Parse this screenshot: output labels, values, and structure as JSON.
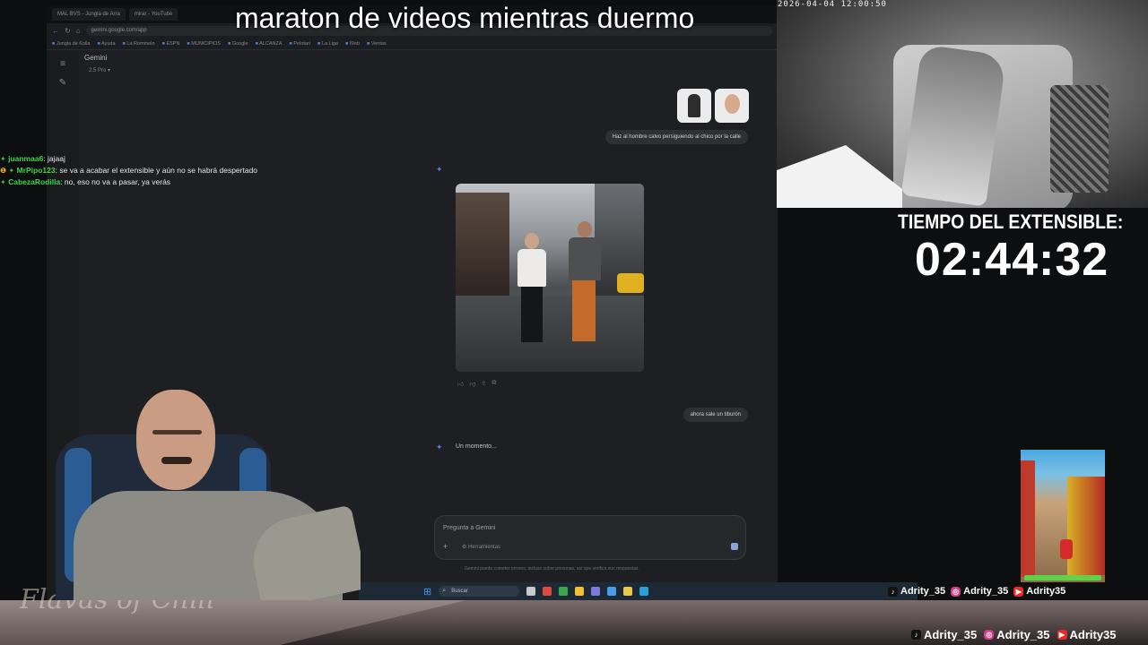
{
  "stream": {
    "title": "maraton de videos mientras duermo",
    "camera_timestamp": "2026-04-04 12:00:50",
    "timer_label": "TIEMPO DEL EXTENSIBLE:",
    "timer_value": "02:44:32",
    "watermark": "Flavas of Chill"
  },
  "chat": [
    {
      "icon": "chat-badge-icon",
      "user": "juanmaa6",
      "message": "jajaaj",
      "user_color": "#3cd44a"
    },
    {
      "icon": "warning-badge-icon",
      "user": "MrPipo123",
      "message": "se va a acabar el extensible y aún no se habrá despertado",
      "user_color": "#3cd44a"
    },
    {
      "icon": "chat-badge-icon",
      "user": "CabezaRodilla",
      "message": "no, eso no va a pasar, ya verás",
      "user_color": "#3cd44a"
    }
  ],
  "socials": {
    "top": [
      {
        "network": "tiktok",
        "handle": "Adrity_35"
      },
      {
        "network": "instagram",
        "handle": "Adrity_35"
      },
      {
        "network": "youtube",
        "handle": "Adrity35"
      }
    ],
    "bottom": [
      {
        "network": "tiktok",
        "handle": "Adrity_35"
      },
      {
        "network": "instagram",
        "handle": "Adrity_35"
      },
      {
        "network": "youtube",
        "handle": "Adrity35"
      }
    ]
  },
  "browser": {
    "tabs": [
      "MAL BVS - Jungla de Arra",
      "mirar - YouTube"
    ],
    "url": "gemini.google.com/app",
    "bookmarks": [
      "Jungla de Kolla",
      "Ayuda",
      "La Rommelo",
      "ESPN",
      "MUNICIPIOS",
      "Google",
      "ALCANZA",
      "Pelotari",
      "La Liga",
      "Web",
      "Ventas"
    ],
    "app_name": "Gemini",
    "model_label": "2.5 Pro",
    "messages": {
      "user_prompt_1": "Haz al hombre calvo persiguiendo al chico por la calle",
      "user_prompt_2": "ahora sale un tiburón",
      "thinking": "Un momento..."
    },
    "prompt_placeholder": "Pregunta a Gemini",
    "prompt_tools": "Herramientas",
    "disclaimer": "Gemini puede cometer errores, incluso sobre personas, así que verifica sus respuestas."
  },
  "taskbar": {
    "search_placeholder": "Buscar",
    "apps": [
      "#c9c9c9",
      "#e04a3a",
      "#3aa84a",
      "#f0c030",
      "#7a7ae0",
      "#4a9ae8",
      "#e8c84a",
      "#2aa0d8"
    ]
  },
  "colors": {
    "accent_blue": "#4f7ee8",
    "chat_user": "#3cd44a",
    "youtube_red": "#e52a2a"
  }
}
